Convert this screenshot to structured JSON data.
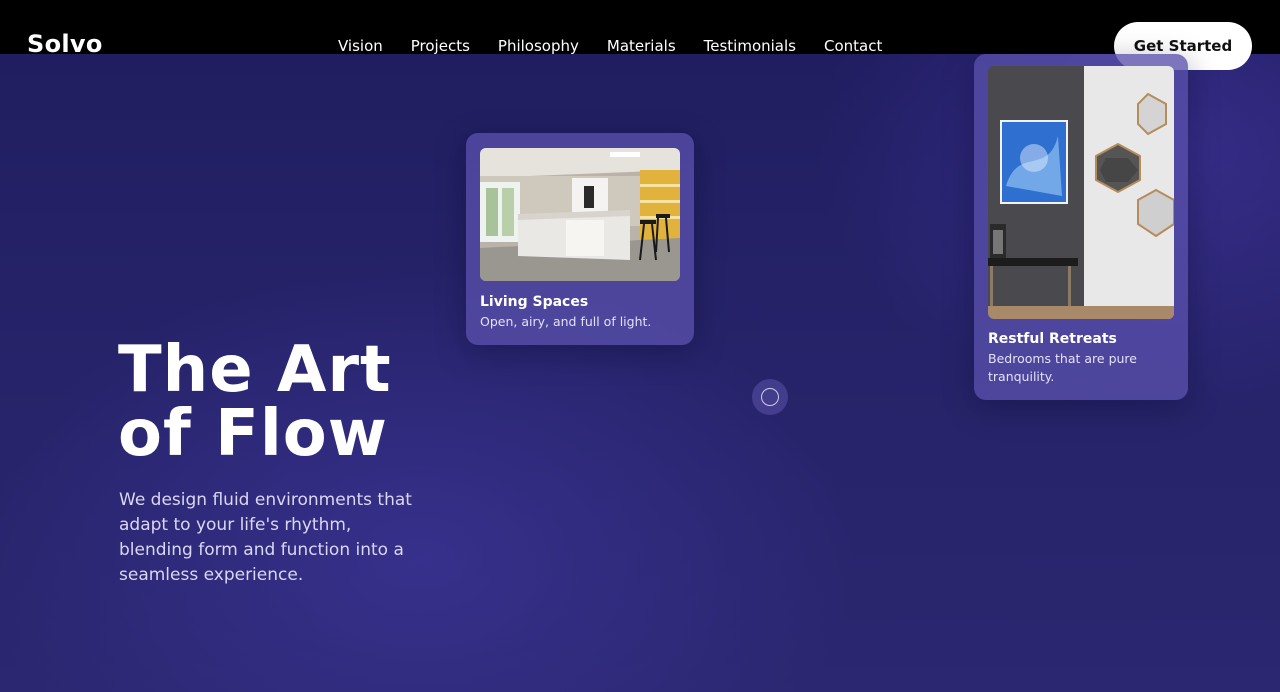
{
  "brand": {
    "name": "Solvo"
  },
  "nav": {
    "items": [
      "Vision",
      "Projects",
      "Philosophy",
      "Materials",
      "Testimonials",
      "Contact"
    ]
  },
  "cta": {
    "label": "Get Started"
  },
  "hero": {
    "title_line1": "The Art",
    "title_line2": "of Flow",
    "subtitle": "We design fluid environments that adapt to your life's rhythm, blending form and function into a seamless experience."
  },
  "cards": [
    {
      "title": "Living Spaces",
      "description": "Open, airy, and full of light.",
      "image": "kitchen-photo"
    },
    {
      "title": "Restful Retreats",
      "description": "Bedrooms that are pure tranquility.",
      "image": "hallway-mirrors-photo"
    }
  ],
  "colors": {
    "background": "#252268",
    "topbar": "#000000",
    "card": "#5850AA",
    "cta_bg": "#FFFFFF",
    "cta_text": "#111111"
  }
}
